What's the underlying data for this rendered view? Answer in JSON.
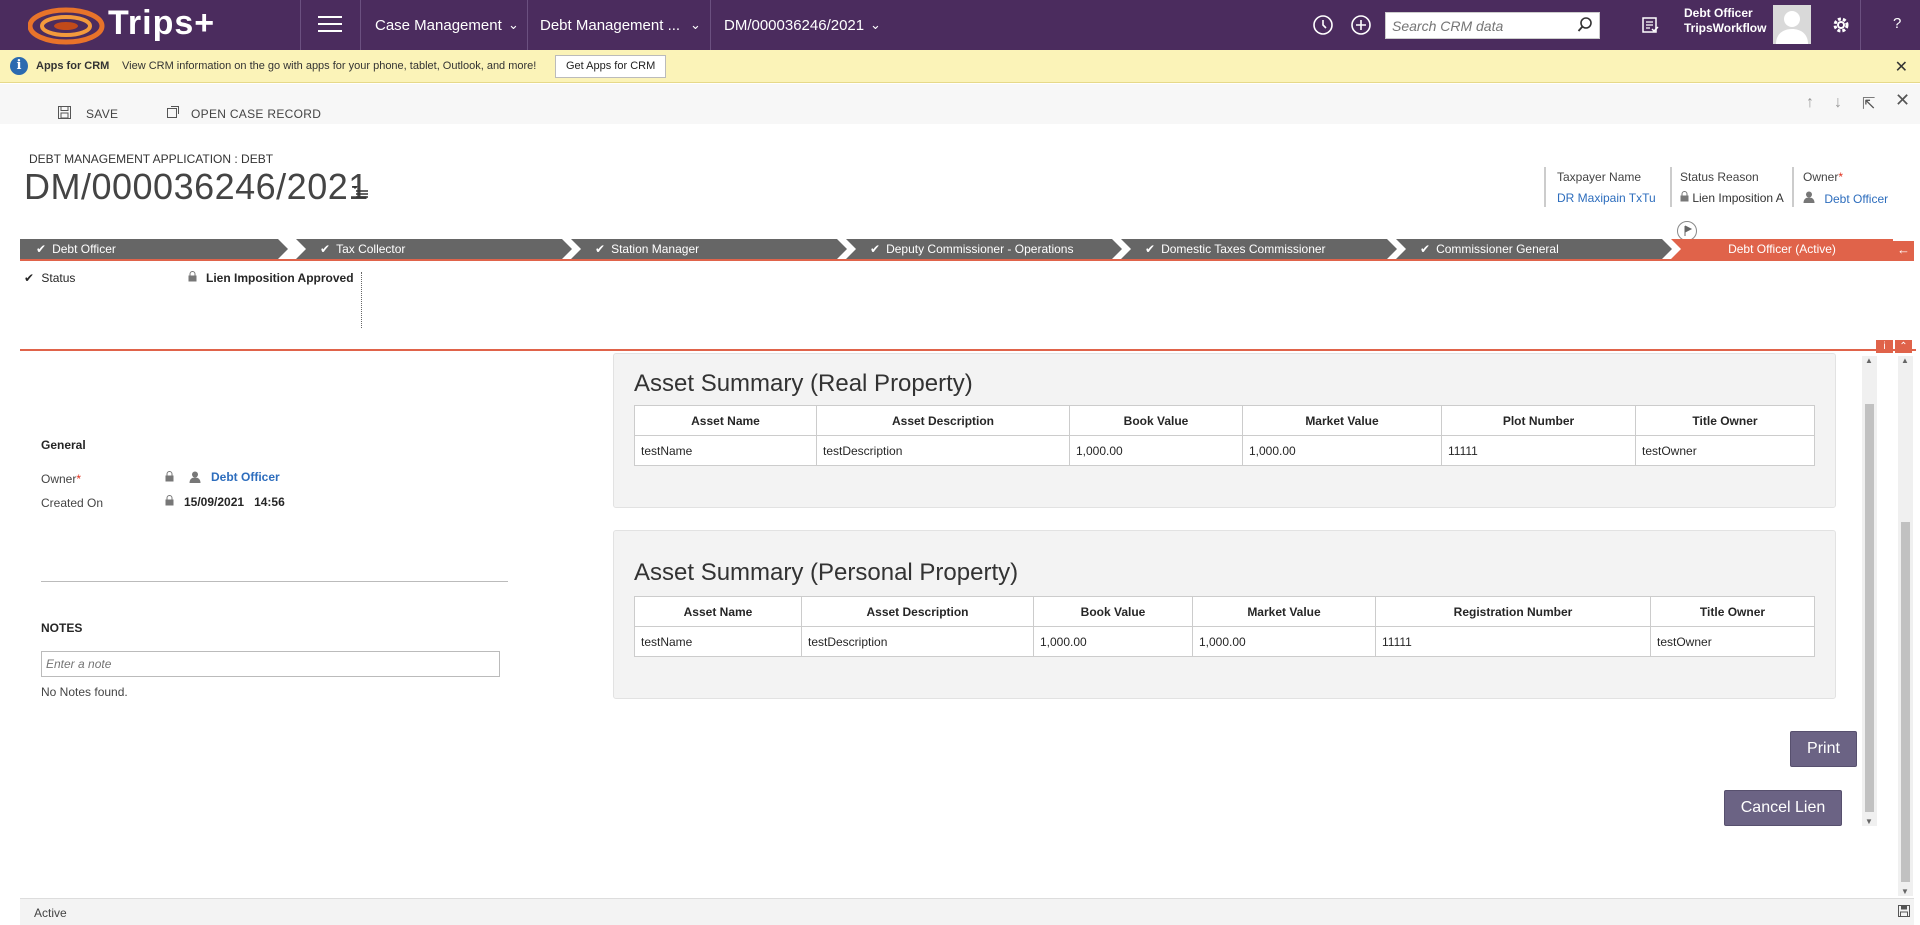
{
  "nav": {
    "brand": "Trips+",
    "links": [
      {
        "label": "Case Management"
      },
      {
        "label": "Debt Management ..."
      },
      {
        "label": "DM/000036246/2021"
      }
    ],
    "search_placeholder": "Search CRM data",
    "user_name": "Debt Officer",
    "user_org": "TripsWorkflow",
    "help": "?",
    "colors": {
      "bar": "#4b2c5e"
    }
  },
  "infobar": {
    "title": "Apps for CRM",
    "text": "View CRM information on the go with apps for your phone, tablet, Outlook, and more!",
    "button": "Get Apps for CRM",
    "close": "✕"
  },
  "commands": {
    "save": "SAVE",
    "open_case": "OPEN CASE RECORD"
  },
  "header": {
    "entity": "DEBT MANAGEMENT APPLICATION : DEBT",
    "title": "DM/000036246/2021",
    "fields": [
      {
        "label": "Taxpayer Name",
        "value": "DR Maxipain TxTu"
      },
      {
        "label": "Status Reason",
        "value": "Lien Imposition A"
      },
      {
        "label": "Owner",
        "value": "Debt Officer"
      }
    ]
  },
  "process": {
    "stages": [
      {
        "label": "Debt Officer",
        "done": true
      },
      {
        "label": "Tax Collector",
        "done": true
      },
      {
        "label": "Station Manager",
        "done": true
      },
      {
        "label": "Deputy Commissioner - Operations",
        "done": true
      },
      {
        "label": "Domestic Taxes Commissioner",
        "done": true
      },
      {
        "label": "Commissioner General",
        "done": true
      },
      {
        "label": "Debt Officer (Active)",
        "done": false
      }
    ],
    "active_color": "#e0634a",
    "done_color": "#666666",
    "step_label": "Status",
    "step_value": "Lien Imposition Approved"
  },
  "general": {
    "title": "General",
    "owner_label": "Owner",
    "owner_value": "Debt Officer",
    "created_label": "Created On",
    "created_date": "15/09/2021",
    "created_time": "14:56"
  },
  "notes": {
    "title": "NOTES",
    "placeholder": "Enter a note",
    "empty": "No Notes found."
  },
  "real_property": {
    "title": "Asset Summary (Real Property)",
    "columns": [
      "Asset Name",
      "Asset Description",
      "Book Value",
      "Market Value",
      "Plot Number",
      "Title Owner"
    ],
    "rows": [
      [
        "testName",
        "testDescription",
        "1,000.00",
        "1,000.00",
        "11111",
        "testOwner"
      ]
    ]
  },
  "personal_property": {
    "title": "Asset Summary (Personal Property)",
    "columns": [
      "Asset Name",
      "Asset Description",
      "Book Value",
      "Market Value",
      "Registration Number",
      "Title Owner"
    ],
    "rows": [
      [
        "testName",
        "testDescription",
        "1,000.00",
        "1,000.00",
        "11111",
        "testOwner"
      ]
    ]
  },
  "actions": {
    "print": "Print",
    "cancel_lien": "Cancel Lien"
  },
  "footer": {
    "status": "Active"
  }
}
